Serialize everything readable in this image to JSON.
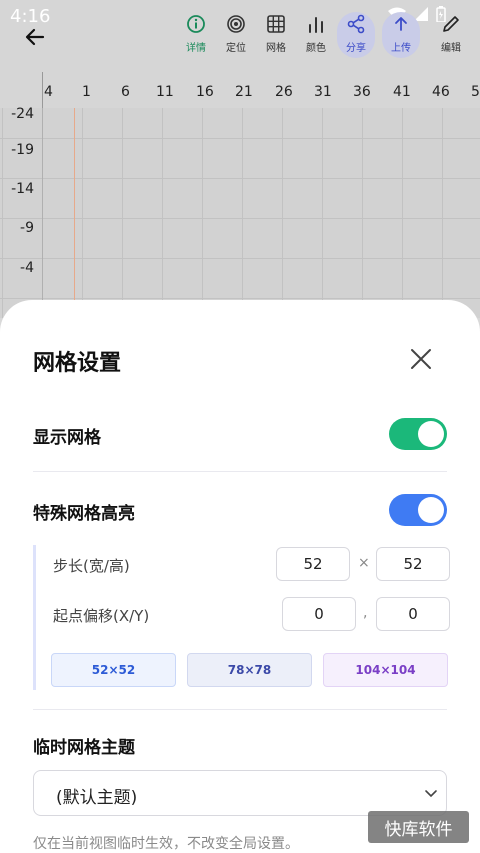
{
  "status": {
    "time": "4:16"
  },
  "toolbar": {
    "tools": [
      {
        "label": "详情",
        "icon": "info-icon"
      },
      {
        "label": "定位",
        "icon": "target-icon"
      },
      {
        "label": "网格",
        "icon": "grid-icon"
      },
      {
        "label": "颜色",
        "icon": "bars-icon"
      },
      {
        "label": "分享",
        "icon": "share-icon"
      },
      {
        "label": "上传",
        "icon": "upload-icon"
      },
      {
        "label": "编辑",
        "icon": "pencil-icon"
      }
    ]
  },
  "ruler": {
    "x_ticks": [
      "4",
      "1",
      "6",
      "11",
      "16",
      "21",
      "26",
      "31",
      "36",
      "41",
      "46",
      "5"
    ],
    "y_ticks": [
      "-24",
      "-19",
      "-14",
      "-9",
      "-4"
    ]
  },
  "sheet": {
    "title": "网格设置",
    "show_grid": {
      "label": "显示网格",
      "on": true,
      "color": "#1bb87a"
    },
    "special_highlight": {
      "label": "特殊网格高亮",
      "on": true,
      "color": "#3f7bf3"
    },
    "step": {
      "label": "步长(宽/高)",
      "width": "52",
      "height": "52",
      "sep": "×"
    },
    "offset": {
      "label": "起点偏移(X/Y)",
      "x": "0",
      "y": "0",
      "sep": ","
    },
    "presets": [
      {
        "label": "52×52",
        "bg": "#eef3fe",
        "border": "#c9d7f8",
        "color": "#2d5bd6"
      },
      {
        "label": "78×78",
        "bg": "#eceff9",
        "border": "#d2d8ef",
        "color": "#3b49a8"
      },
      {
        "label": "104×104",
        "bg": "#f6f0fd",
        "border": "#e3d4f6",
        "color": "#7a3fc6"
      }
    ],
    "theme": {
      "label": "临时网格主题",
      "value": "(默认主题)"
    },
    "hint": "仅在当前视图临时生效，不改变全局设置。"
  },
  "watermark": "快库软件"
}
